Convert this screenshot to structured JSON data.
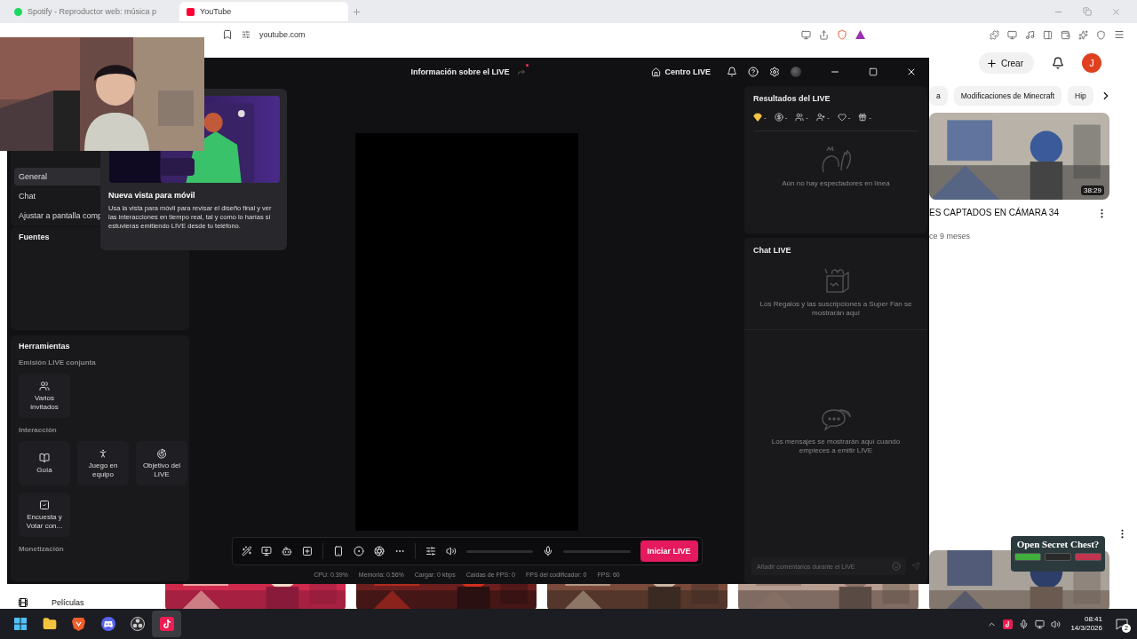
{
  "browser": {
    "tabs": [
      {
        "kind": "spotify",
        "label": "Spotify - Reproductor web: música p",
        "selected": false
      },
      {
        "kind": "youtube",
        "label": "YouTube",
        "selected": true
      }
    ],
    "url": "youtube.com"
  },
  "youtube": {
    "create_button": "Crear",
    "avatar": "J",
    "chips": [
      "a",
      "Modificaciones de Minecraft",
      "Hip"
    ],
    "video": {
      "duration": "38:29",
      "title": "ES CAPTADOS EN CÁMARA 34",
      "meta": "ce 9 meses"
    },
    "thumbnails": [
      {
        "kind": "picture"
      },
      {
        "kind": "picture"
      },
      {
        "kind": "picture"
      },
      {
        "kind": "picture"
      },
      {
        "kind": "picture"
      }
    ],
    "sidebar_item": "Películas"
  },
  "studio": {
    "title": "Información sobre el LIVE",
    "live_center": "Centro LIVE",
    "menu": [
      {
        "label": "General",
        "selected": true
      },
      {
        "label": "Chat",
        "selected": false
      },
      {
        "label": "Ajustar a pantalla comp",
        "selected": false
      }
    ],
    "sources_title": "Fuentes",
    "tools": {
      "title": "Herramientas",
      "sections": [
        {
          "title": "Emisión LIVE conjunta",
          "items": [
            {
              "kind": "users",
              "label": "Varios invitados"
            }
          ]
        },
        {
          "title": "Interacción",
          "items": [
            {
              "kind": "guide",
              "label": "Guía"
            },
            {
              "kind": "team",
              "label": "Juego en equipo"
            },
            {
              "kind": "goal",
              "label": "Objetivo del LIVE"
            },
            {
              "kind": "poll",
              "label": "Encuesta y Votar con..."
            }
          ]
        },
        {
          "title": "Monetización"
        }
      ]
    },
    "popup": {
      "title": "Nueva vista para móvil",
      "text": "Usa la vista para móvil para revisar el diseño final y ver las interacciones en tiempo real, tal y como lo harías si estuvieras emitiendo LIVE desde tu teléfono."
    },
    "volume": {
      "level": 0
    },
    "mic": {
      "level": 0
    },
    "start_button": "Iniciar LIVE",
    "stats": [
      "CPU: 0.39%",
      "Memoria: 0.56%",
      "Cargar: 0 kbps",
      "Caídas de FPS: 0",
      "FPS del codificador: 0",
      "FPS: 60"
    ],
    "results": {
      "title": "Resultados del LIVE",
      "metrics": [
        {
          "kind": "diamond",
          "value": "-"
        },
        {
          "kind": "coin",
          "value": "-"
        },
        {
          "kind": "viewers",
          "value": "-"
        },
        {
          "kind": "follower",
          "value": "-"
        },
        {
          "kind": "heart",
          "value": "-"
        },
        {
          "kind": "gift",
          "value": "-"
        }
      ],
      "empty": "Aún no hay espectadores en línea"
    },
    "chat": {
      "title": "Chat LIVE",
      "gifts_empty": "Los Regalos y las suscripciones a Super Fan se mostrarán aquí",
      "messages_empty": "Los mensajes se mostrarán aquí cuando empieces a emitir LIVE",
      "placeholder": "Añadir comentarios durante el LIVE"
    }
  },
  "overlay": {
    "title": "Open Secret Chest?",
    "options": [
      {
        "color": "#3fae3a"
      },
      {
        "color": "#2a2a2a"
      },
      {
        "color": "#c2344e"
      }
    ]
  },
  "taskbar": {
    "apps": [
      {
        "kind": "explorer",
        "selected": false
      },
      {
        "kind": "brave",
        "selected": false
      },
      {
        "kind": "discord",
        "selected": false
      },
      {
        "kind": "obs",
        "selected": false
      },
      {
        "kind": "tiktok",
        "selected": true
      }
    ],
    "time": "08:41",
    "date": "14/3/2026",
    "notifications": "2"
  }
}
